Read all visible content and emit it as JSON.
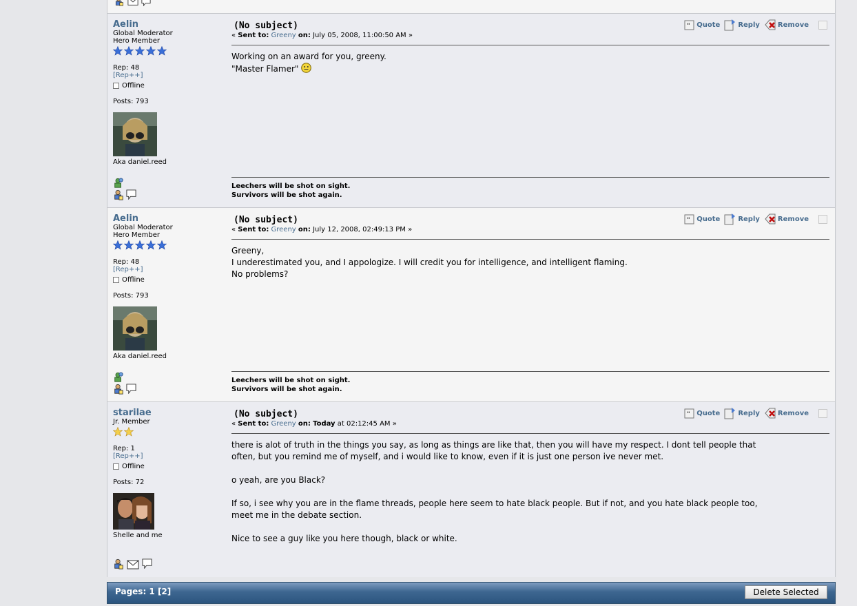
{
  "page": {
    "pages_label": "Pages: 1 [2]",
    "delete_button": "Delete Selected"
  },
  "actions": {
    "quote": "Quote",
    "reply": "Reply",
    "remove": "Remove"
  },
  "messages": [
    {
      "author": "Aelin",
      "title": "Global Moderator",
      "group": "Hero Member",
      "stars": 5,
      "rep": "Rep: 48",
      "rep_plus": "[Rep++]",
      "status": "Offline",
      "posts": "Posts: 793",
      "personal_text": "Aka daniel.reed",
      "subject": "(No subject)",
      "sent_label": "Sent to:",
      "recipient": "Greeny",
      "on_label": "on:",
      "date": "July 05, 2008, 11:00:50 AM",
      "body": "Working on an award for you, greeny.\n\"Master Flamer\"",
      "signature": [
        "Leechers will be shot on sight.",
        "Survivors will be shot again."
      ]
    },
    {
      "author": "Aelin",
      "title": "Global Moderator",
      "group": "Hero Member",
      "stars": 5,
      "rep": "Rep: 48",
      "rep_plus": "[Rep++]",
      "status": "Offline",
      "posts": "Posts: 793",
      "personal_text": "Aka daniel.reed",
      "subject": "(No subject)",
      "sent_label": "Sent to:",
      "recipient": "Greeny",
      "on_label": "on:",
      "date": "July 12, 2008, 02:49:13 PM",
      "body": "Greeny,\nI underestimated you, and I appologize. I will credit you for intelligence, and intelligent flaming.\nNo problems?",
      "signature": [
        "Leechers will be shot on sight.",
        "Survivors will be shot again."
      ]
    },
    {
      "author": "starilae",
      "title": "Jr. Member",
      "stars": 2,
      "rep": "Rep: 1",
      "rep_plus": "[Rep++]",
      "status": "Offline",
      "posts": "Posts: 72",
      "personal_text": "Shelle and me",
      "subject": "(No subject)",
      "sent_label": "Sent to:",
      "recipient": "Greeny",
      "on_label": "on:",
      "date_bold": "Today",
      "date": "at 02:12:45 AM",
      "body": "there is alot of truth in the things you say, as long as things are like that, then you will have my respect. I dont tell people that\noften, but you remind me of myself, and i would like to know, even if it is just one person ive never met.\n\no yeah, are you Black?\n\nIf so, i see why you are in the flame threads, people here seem to hate black people. But if not, and you hate black people too,\nmeet me in the debate section.\n\nNice to see a guy like you here though, black or white."
    }
  ],
  "colors": {
    "link": "#476c8e",
    "footer_top": "#7e9cc0",
    "footer_bottom": "#2c557f",
    "alt_row": "#ebecf1"
  }
}
